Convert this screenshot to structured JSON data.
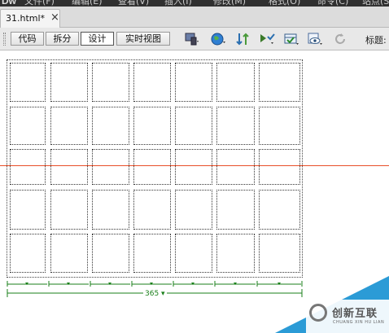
{
  "app": {
    "logo": "Dw"
  },
  "menubar": {
    "items": [
      "文件(F)",
      "编辑(E)",
      "查看(V)",
      "插入(I)",
      "修改(M)",
      "格式(O)",
      "命令(C)",
      "站点(S)"
    ]
  },
  "document_tab": {
    "label": "31.html*",
    "close": "×"
  },
  "toolbar": {
    "views": [
      "代码",
      "拆分",
      "设计",
      "实时视图"
    ],
    "active_view": "设计",
    "title_label": "标题:"
  },
  "table": {
    "total_width": "365"
  },
  "colors": {
    "guide": "#e8502a",
    "ruler": "#1a7f1a",
    "brand": "#2b9bd6"
  },
  "brand": {
    "name": "创新互联",
    "sub": "CHUANG XIN HU LIAN"
  }
}
